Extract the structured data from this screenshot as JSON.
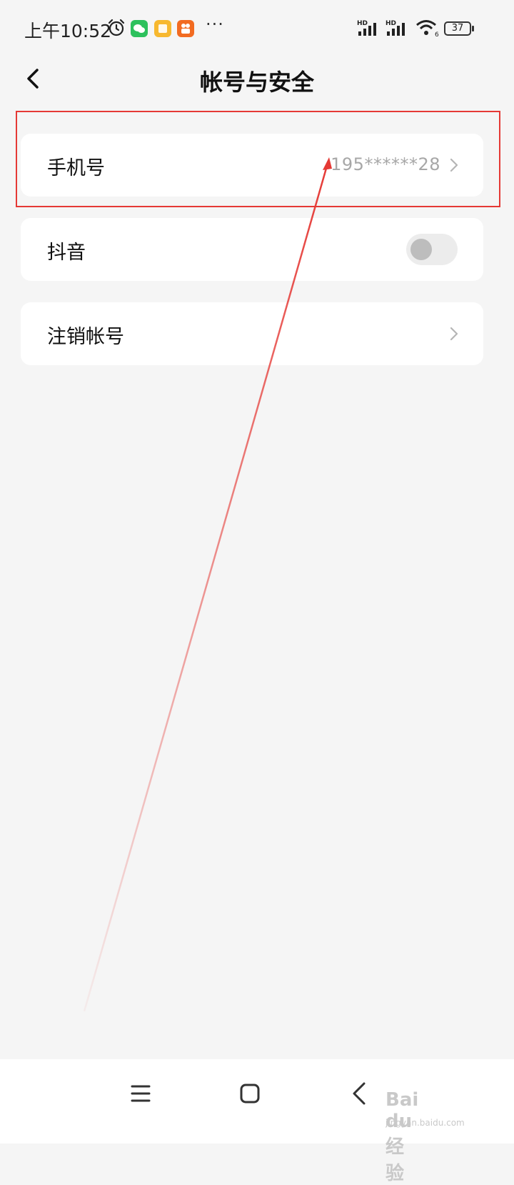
{
  "status_bar": {
    "time": "上午10:52",
    "network_label_1": "HD",
    "network_label_2": "HD",
    "wifi_label": "6",
    "battery": "37",
    "more": "···"
  },
  "header": {
    "title": "帐号与安全"
  },
  "rows": [
    {
      "label": "手机号",
      "value": "195******28"
    },
    {
      "label": "抖音",
      "toggle_on": false
    },
    {
      "label": "注销帐号"
    }
  ],
  "annotation": {
    "color": "#e53935"
  },
  "watermark": {
    "brand": "Bai du 经验",
    "domain": "jingyan.baidu.com"
  },
  "colors": {
    "background": "#f5f5f5",
    "card": "#ffffff",
    "secondary_text": "#a7a7a7",
    "wechat_green": "#2dc15d",
    "app_yellow": "#f7b82f",
    "app_orange": "#f26b21"
  }
}
